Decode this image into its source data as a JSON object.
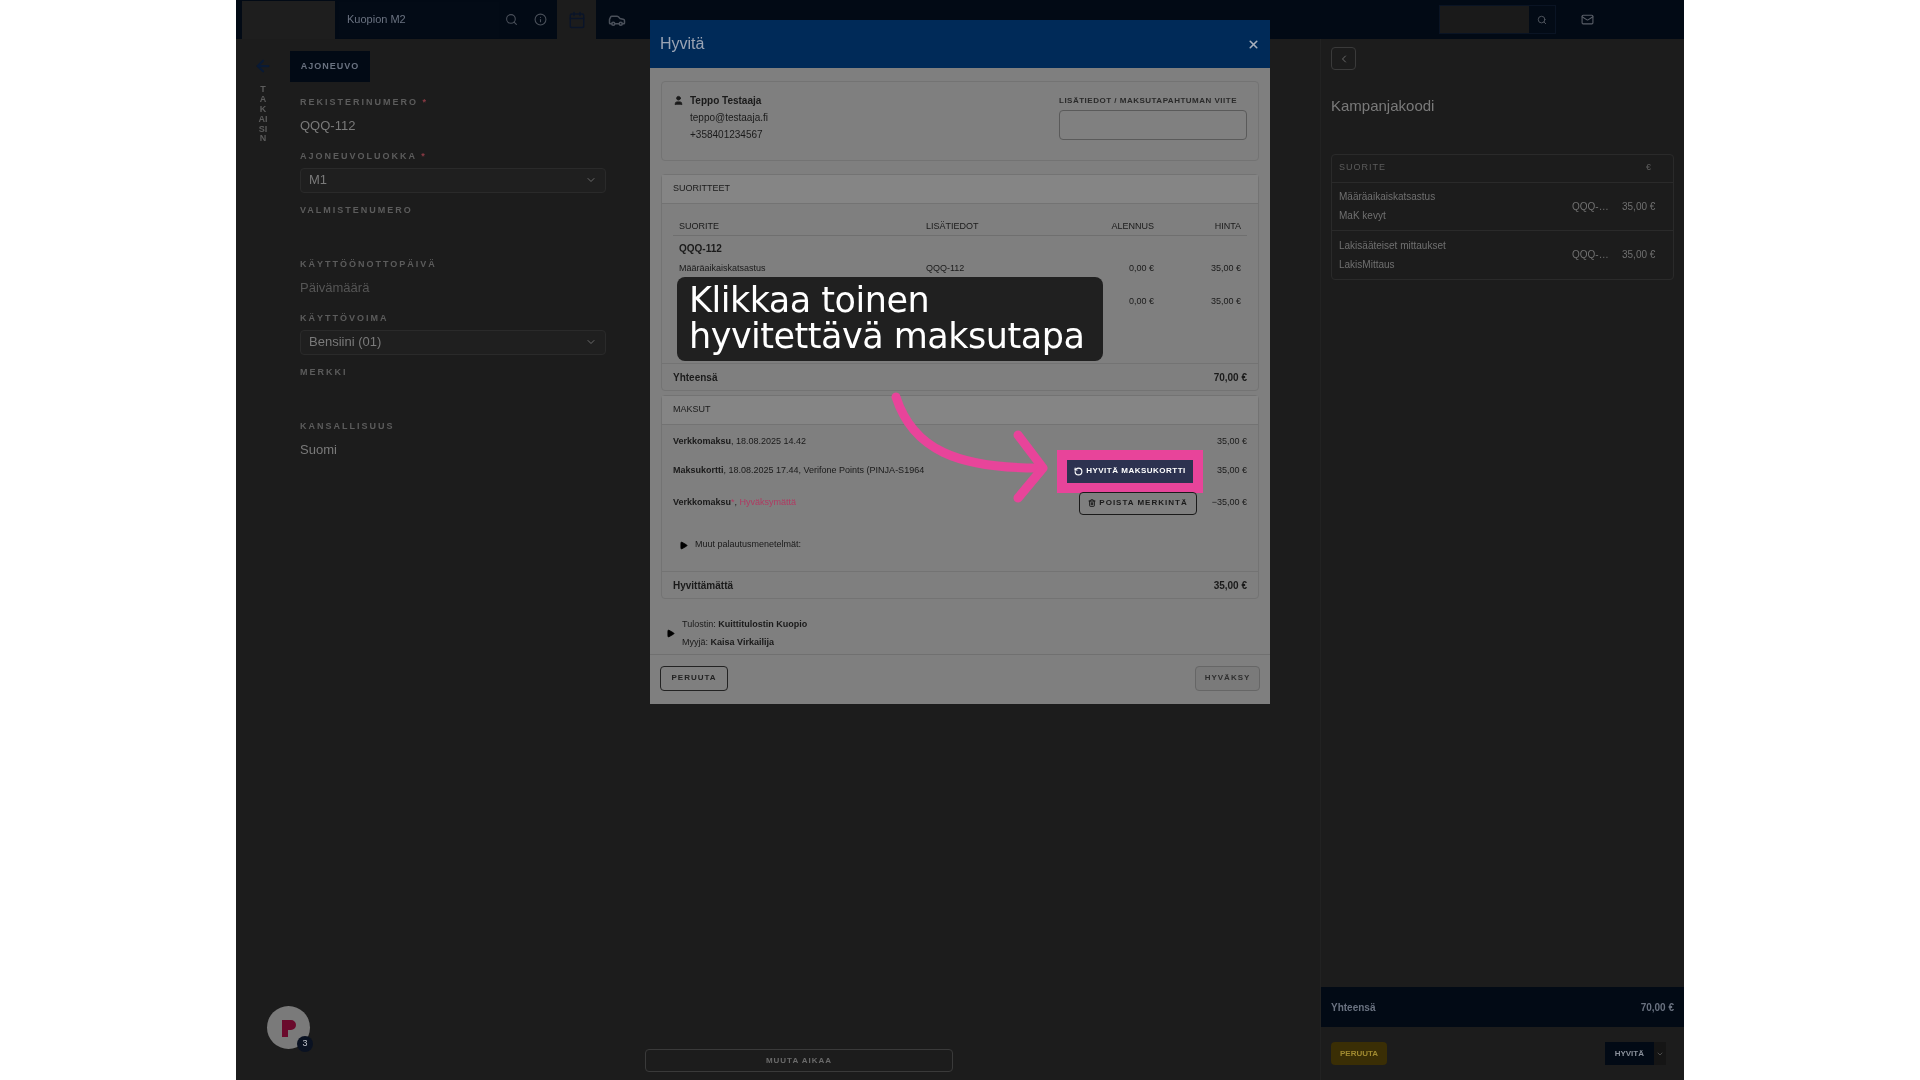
{
  "top_bar": {
    "location": "Kuopion M2"
  },
  "back": {
    "label": "TAKAISIN"
  },
  "vehicle_panel": {
    "tab": "AJONEUVO",
    "fields": [
      {
        "label": "REKISTERINUMERO",
        "mark": "*",
        "kind": "text",
        "value": "QQQ-112"
      },
      {
        "label": "AJONEUVOLUOKKA",
        "mark": "*",
        "kind": "select",
        "value": "M1"
      },
      {
        "label": "VALMISTENUMERO",
        "kind": "text"
      },
      {
        "label": "KÄYTTÖÖNOTTOPÄIVÄ",
        "kind": "text",
        "placeholder": "Päivämäärä"
      },
      {
        "label": "KÄYTTÖVOIMA",
        "kind": "select",
        "value": "Bensiini (01)"
      },
      {
        "label": "MERKKI",
        "kind": "text"
      },
      {
        "label": "KANSALLISUUS",
        "kind": "text",
        "value": "Suomi"
      }
    ]
  },
  "middle": {
    "button": "MUUTA AIKAA"
  },
  "cart": {
    "title": "Kampanjakoodi",
    "columns": [
      "SUORITE",
      "€"
    ],
    "rows": [
      {
        "name": "Määräaikaiskatsastus",
        "sub": "MaK kevyt",
        "plate": "QQQ-…",
        "price": "35,00 €"
      },
      {
        "name": "Lakisääteiset mittaukset",
        "sub": "LakisMittaus",
        "plate": "QQQ-…",
        "price": "35,00 €"
      }
    ],
    "total_label": "Yhteensä",
    "total": "70,00 €",
    "left_button": "PERUUTA",
    "right_button": "HYVITÄ"
  },
  "modal": {
    "title": "Hyvitä",
    "customer": {
      "name": "Teppo Testaaja",
      "email": "teppo@testaaja.fi",
      "phone": "+358401234567"
    },
    "reference": {
      "label": "LISÄTIEDOT / MAKSUTAPAHTUMAN VIITE"
    },
    "services": {
      "title": "SUORITTEET",
      "columns": [
        "SUORITE",
        "LISÄTIEDOT",
        "ALENNUS",
        "HINTA"
      ],
      "group": "QQQ-112",
      "rows": [
        {
          "name": "Määräaikaiskatsastus",
          "info": "QQQ-112",
          "discount": "0,00 €",
          "price": "35,00 €"
        },
        {
          "discount": "0,00 €",
          "price": "35,00 €"
        }
      ],
      "total_label": "Yhteensä",
      "total": "70,00 €"
    },
    "payments": {
      "title": "MAKSUT",
      "rows": [
        {
          "method": "Verkkomaksu",
          "details": ", 18.08.2025 14.42",
          "amount": "35,00 €"
        },
        {
          "method": "Maksukortti",
          "details": ", 18.08.2025 17.44, Verifone Points (PINJA-S1964",
          "amount": "35,00 €",
          "action": {
            "kind": "refund",
            "label": "HYVITÄ MAKSUKORTTI",
            "highlighted": true
          }
        },
        {
          "method": "Verkkomaksu",
          "mark": "*",
          "details": ", ",
          "status": "Hyväksymättä",
          "amount": "−35,00 €",
          "action": {
            "kind": "delete",
            "label": "POISTA MERKINTÄ",
            "highlighted": false
          }
        }
      ],
      "other_methods": "Muut palautusmenetelmät:",
      "unrefunded_label": "Hyvittämättä",
      "unrefunded": "35,00 €"
    },
    "printer": {
      "label": "Tulostin:",
      "value": "Kuittitulostin Kuopio"
    },
    "seller": {
      "label": "Myyjä:",
      "value": "Kaisa Virkailija"
    },
    "cancel": "PERUUTA",
    "approve": {
      "label": "HYVÄKSY",
      "disabled": true
    }
  },
  "tutorial": {
    "text": "Klikkaa toinen hyvitettävä maksutapa"
  },
  "chat_badge": {
    "count": "3"
  }
}
